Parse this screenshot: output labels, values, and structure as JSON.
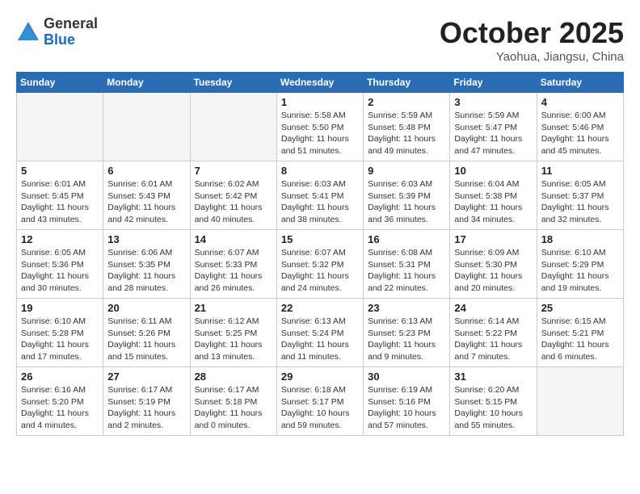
{
  "logo": {
    "general": "General",
    "blue": "Blue"
  },
  "title": "October 2025",
  "location": "Yaohua, Jiangsu, China",
  "weekdays": [
    "Sunday",
    "Monday",
    "Tuesday",
    "Wednesday",
    "Thursday",
    "Friday",
    "Saturday"
  ],
  "weeks": [
    [
      {
        "day": "",
        "info": ""
      },
      {
        "day": "",
        "info": ""
      },
      {
        "day": "",
        "info": ""
      },
      {
        "day": "1",
        "info": "Sunrise: 5:58 AM\nSunset: 5:50 PM\nDaylight: 11 hours\nand 51 minutes."
      },
      {
        "day": "2",
        "info": "Sunrise: 5:59 AM\nSunset: 5:48 PM\nDaylight: 11 hours\nand 49 minutes."
      },
      {
        "day": "3",
        "info": "Sunrise: 5:59 AM\nSunset: 5:47 PM\nDaylight: 11 hours\nand 47 minutes."
      },
      {
        "day": "4",
        "info": "Sunrise: 6:00 AM\nSunset: 5:46 PM\nDaylight: 11 hours\nand 45 minutes."
      }
    ],
    [
      {
        "day": "5",
        "info": "Sunrise: 6:01 AM\nSunset: 5:45 PM\nDaylight: 11 hours\nand 43 minutes."
      },
      {
        "day": "6",
        "info": "Sunrise: 6:01 AM\nSunset: 5:43 PM\nDaylight: 11 hours\nand 42 minutes."
      },
      {
        "day": "7",
        "info": "Sunrise: 6:02 AM\nSunset: 5:42 PM\nDaylight: 11 hours\nand 40 minutes."
      },
      {
        "day": "8",
        "info": "Sunrise: 6:03 AM\nSunset: 5:41 PM\nDaylight: 11 hours\nand 38 minutes."
      },
      {
        "day": "9",
        "info": "Sunrise: 6:03 AM\nSunset: 5:39 PM\nDaylight: 11 hours\nand 36 minutes."
      },
      {
        "day": "10",
        "info": "Sunrise: 6:04 AM\nSunset: 5:38 PM\nDaylight: 11 hours\nand 34 minutes."
      },
      {
        "day": "11",
        "info": "Sunrise: 6:05 AM\nSunset: 5:37 PM\nDaylight: 11 hours\nand 32 minutes."
      }
    ],
    [
      {
        "day": "12",
        "info": "Sunrise: 6:05 AM\nSunset: 5:36 PM\nDaylight: 11 hours\nand 30 minutes."
      },
      {
        "day": "13",
        "info": "Sunrise: 6:06 AM\nSunset: 5:35 PM\nDaylight: 11 hours\nand 28 minutes."
      },
      {
        "day": "14",
        "info": "Sunrise: 6:07 AM\nSunset: 5:33 PM\nDaylight: 11 hours\nand 26 minutes."
      },
      {
        "day": "15",
        "info": "Sunrise: 6:07 AM\nSunset: 5:32 PM\nDaylight: 11 hours\nand 24 minutes."
      },
      {
        "day": "16",
        "info": "Sunrise: 6:08 AM\nSunset: 5:31 PM\nDaylight: 11 hours\nand 22 minutes."
      },
      {
        "day": "17",
        "info": "Sunrise: 6:09 AM\nSunset: 5:30 PM\nDaylight: 11 hours\nand 20 minutes."
      },
      {
        "day": "18",
        "info": "Sunrise: 6:10 AM\nSunset: 5:29 PM\nDaylight: 11 hours\nand 19 minutes."
      }
    ],
    [
      {
        "day": "19",
        "info": "Sunrise: 6:10 AM\nSunset: 5:28 PM\nDaylight: 11 hours\nand 17 minutes."
      },
      {
        "day": "20",
        "info": "Sunrise: 6:11 AM\nSunset: 5:26 PM\nDaylight: 11 hours\nand 15 minutes."
      },
      {
        "day": "21",
        "info": "Sunrise: 6:12 AM\nSunset: 5:25 PM\nDaylight: 11 hours\nand 13 minutes."
      },
      {
        "day": "22",
        "info": "Sunrise: 6:13 AM\nSunset: 5:24 PM\nDaylight: 11 hours\nand 11 minutes."
      },
      {
        "day": "23",
        "info": "Sunrise: 6:13 AM\nSunset: 5:23 PM\nDaylight: 11 hours\nand 9 minutes."
      },
      {
        "day": "24",
        "info": "Sunrise: 6:14 AM\nSunset: 5:22 PM\nDaylight: 11 hours\nand 7 minutes."
      },
      {
        "day": "25",
        "info": "Sunrise: 6:15 AM\nSunset: 5:21 PM\nDaylight: 11 hours\nand 6 minutes."
      }
    ],
    [
      {
        "day": "26",
        "info": "Sunrise: 6:16 AM\nSunset: 5:20 PM\nDaylight: 11 hours\nand 4 minutes."
      },
      {
        "day": "27",
        "info": "Sunrise: 6:17 AM\nSunset: 5:19 PM\nDaylight: 11 hours\nand 2 minutes."
      },
      {
        "day": "28",
        "info": "Sunrise: 6:17 AM\nSunset: 5:18 PM\nDaylight: 11 hours\nand 0 minutes."
      },
      {
        "day": "29",
        "info": "Sunrise: 6:18 AM\nSunset: 5:17 PM\nDaylight: 10 hours\nand 59 minutes."
      },
      {
        "day": "30",
        "info": "Sunrise: 6:19 AM\nSunset: 5:16 PM\nDaylight: 10 hours\nand 57 minutes."
      },
      {
        "day": "31",
        "info": "Sunrise: 6:20 AM\nSunset: 5:15 PM\nDaylight: 10 hours\nand 55 minutes."
      },
      {
        "day": "",
        "info": ""
      }
    ]
  ]
}
